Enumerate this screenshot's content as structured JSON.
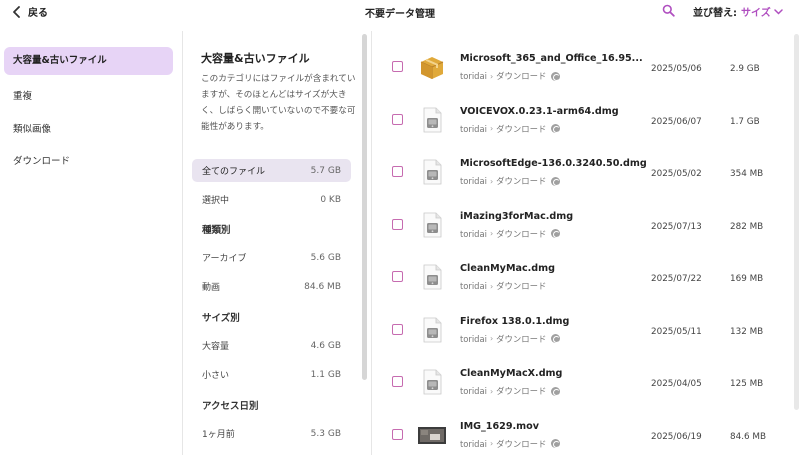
{
  "header": {
    "back_label": "戻る",
    "title": "不要データ管理",
    "sort_label": "並び替え:",
    "sort_value": "サイズ"
  },
  "sidebar": {
    "items": [
      {
        "label": "大容量&古いファイル",
        "active": true
      },
      {
        "label": "重複",
        "active": false
      },
      {
        "label": "類似画像",
        "active": false
      },
      {
        "label": "ダウンロード",
        "active": false
      }
    ]
  },
  "category": {
    "title": "大容量&古いファイル",
    "description": "このカテゴリにはファイルが含まれていますが、そのほとんどはサイズが大きく、しばらく開いていないので不要な可能性があります。",
    "all_files": {
      "label": "全てのファイル",
      "size": "5.7 GB"
    },
    "selected": {
      "label": "選択中",
      "size": "0 KB"
    },
    "by_type_heading": "種類別",
    "by_type": [
      {
        "label": "アーカイブ",
        "size": "5.6 GB"
      },
      {
        "label": "動画",
        "size": "84.6 MB"
      }
    ],
    "by_size_heading": "サイズ別",
    "by_size": [
      {
        "label": "大容量",
        "size": "4.6 GB"
      },
      {
        "label": "小さい",
        "size": "1.1 GB"
      }
    ],
    "by_access_heading": "アクセス日別",
    "by_access": [
      {
        "label": "1ヶ月前",
        "size": "5.3 GB"
      }
    ]
  },
  "files": [
    {
      "name": "Microsoft_365_and_Office_16.95...",
      "user": "toridai",
      "folder": "ダウンロード",
      "badge": true,
      "date": "2025/05/06",
      "size": "2.9 GB",
      "icon": "package-icon"
    },
    {
      "name": "VOICEVOX.0.23.1-arm64.dmg",
      "user": "toridai",
      "folder": "ダウンロード",
      "badge": true,
      "date": "2025/06/07",
      "size": "1.7 GB",
      "icon": "dmg-file-icon"
    },
    {
      "name": "MicrosoftEdge-136.0.3240.50.dmg",
      "user": "toridai",
      "folder": "ダウンロード",
      "badge": true,
      "date": "2025/05/02",
      "size": "354 MB",
      "icon": "dmg-file-icon"
    },
    {
      "name": "iMazing3forMac.dmg",
      "user": "toridai",
      "folder": "ダウンロード",
      "badge": true,
      "date": "2025/07/13",
      "size": "282 MB",
      "icon": "dmg-file-icon"
    },
    {
      "name": "CleanMyMac.dmg",
      "user": "toridai",
      "folder": "ダウンロード",
      "badge": false,
      "date": "2025/07/22",
      "size": "169 MB",
      "icon": "dmg-file-icon"
    },
    {
      "name": "Firefox 138.0.1.dmg",
      "user": "toridai",
      "folder": "ダウンロード",
      "badge": true,
      "date": "2025/05/11",
      "size": "132 MB",
      "icon": "dmg-file-icon"
    },
    {
      "name": "CleanMyMacX.dmg",
      "user": "toridai",
      "folder": "ダウンロード",
      "badge": true,
      "date": "2025/04/05",
      "size": "125 MB",
      "icon": "dmg-file-icon"
    },
    {
      "name": "IMG_1629.mov",
      "user": "toridai",
      "folder": "ダウンロード",
      "badge": true,
      "date": "2025/06/19",
      "size": "84.6 MB",
      "icon": "video-thumbnail-icon"
    }
  ],
  "colors": {
    "accent": "#b04fc0",
    "sidebar_active": "#e7d4f6",
    "checkbox_border": "#c66bb0"
  }
}
